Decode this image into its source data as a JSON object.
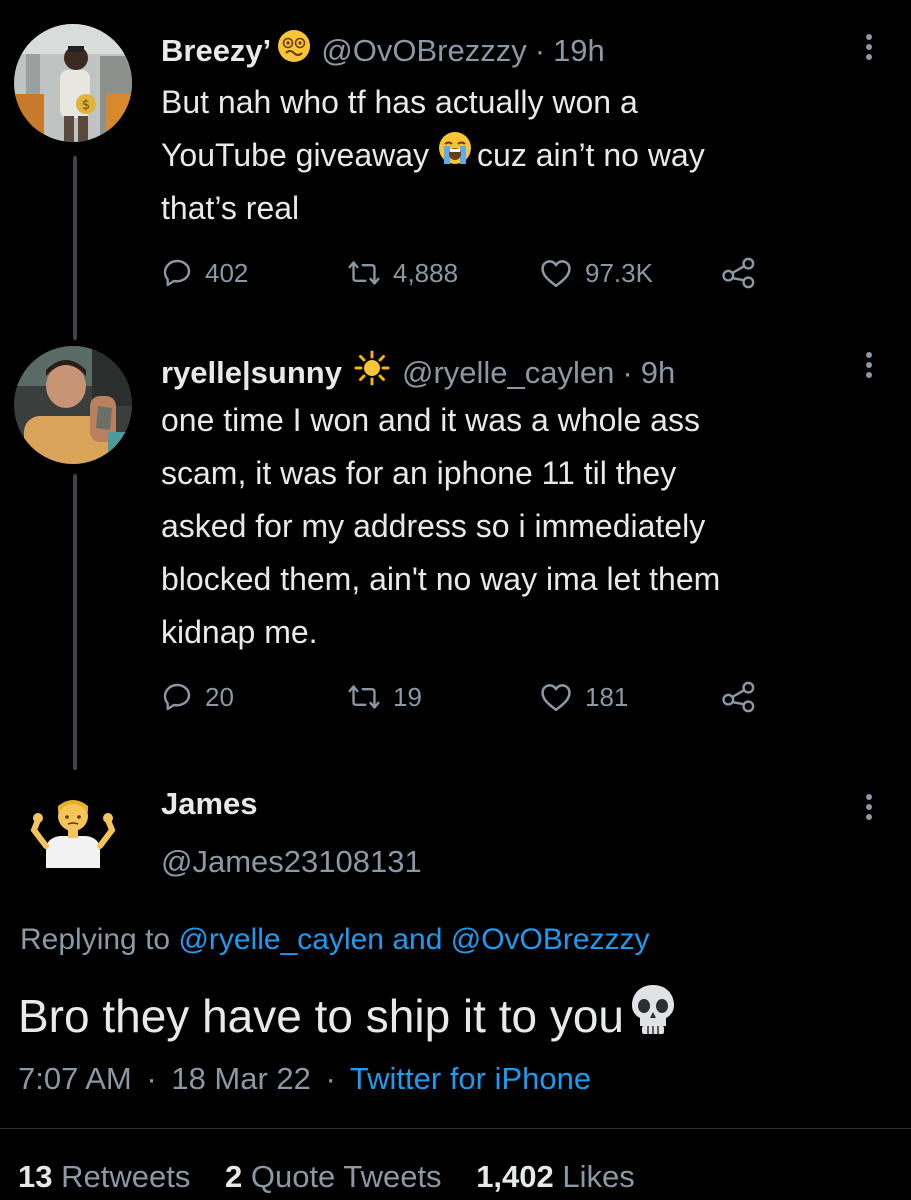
{
  "tweets": [
    {
      "name": "Breezy’",
      "handle": "@OvOBrezzzy",
      "sep": "·",
      "time": "19h",
      "lines": [
        "But nah who tf has actually won a",
        "YouTube giveaway",
        "cuz ain’t no way",
        "that’s real"
      ],
      "replies": "402",
      "retweets": "4,888",
      "likes": "97.3K"
    },
    {
      "name": "ryelle|sunny",
      "handle": "@ryelle_caylen",
      "sep": "·",
      "time": "9h",
      "lines": [
        "one time I won and it was a whole ass",
        "scam, it was for an iphone 11 til they",
        "asked for my address so i immediately",
        "blocked them, ain't no way ima let them",
        "kidnap me."
      ],
      "replies": "20",
      "retweets": "19",
      "likes": "181"
    }
  ],
  "main_tweet": {
    "name": "James",
    "handle": "@James23108131",
    "replying_prefix": "Replying to",
    "reply_handle_1": "@ryelle_caylen",
    "replying_and": "and",
    "reply_handle_2": "@OvOBrezzzy",
    "text": "Bro they have to ship it to you",
    "time": "7:07 AM",
    "sep": "·",
    "date": "18 Mar 22",
    "source": "Twitter for iPhone",
    "stats": {
      "retweets_count": "13",
      "retweets_label": "Retweets",
      "quotes_count": "2",
      "quotes_label": "Quote Tweets",
      "likes_count": "1,402",
      "likes_label": "Likes"
    }
  },
  "icons": {
    "reply": "reply-icon",
    "retweet": "retweet-icon",
    "like": "heart-icon",
    "share": "share-icon",
    "more": "more-vertical-icon",
    "woozy": "woozy-face-emoji",
    "crying": "loudly-crying-face-emoji",
    "sun": "sun-emoji",
    "shrug": "person-shrugging-emoji",
    "skull": "skull-emoji"
  },
  "colors": {
    "background": "#000000",
    "text": "#e7e9ea",
    "secondary": "#8b98a5",
    "link": "#1d9bf0",
    "thread_line": "#3d4449"
  }
}
